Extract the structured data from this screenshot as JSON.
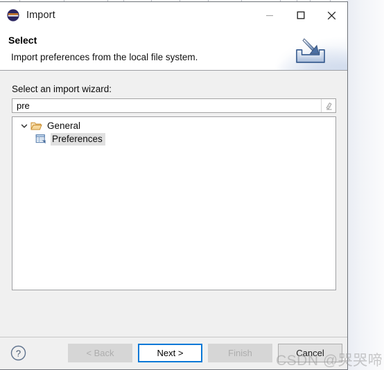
{
  "window": {
    "title": "Import",
    "app_icon": "eclipse-logo-icon",
    "controls": {
      "minimize": "minimize-icon",
      "maximize": "maximize-icon",
      "close": "close-icon"
    }
  },
  "banner": {
    "title": "Select",
    "description": "Import preferences from the local file system.",
    "icon": "import-tray-arrow-icon"
  },
  "form": {
    "wizard_label": "Select an import wizard:",
    "filter_value": "pre",
    "filter_placeholder": "",
    "clear_icon": "eraser-clear-icon"
  },
  "tree": {
    "nodes": [
      {
        "label": "General",
        "icon": "open-folder-icon",
        "expanded": true,
        "selected": false,
        "twisty": "chevron-down-icon",
        "children": [
          {
            "label": "Preferences",
            "icon": "preferences-table-icon",
            "selected": true
          }
        ]
      }
    ]
  },
  "footer": {
    "help_icon": "help-question-icon",
    "buttons": [
      {
        "label": "< Back",
        "state": "disabled"
      },
      {
        "label": "Next >",
        "state": "default"
      },
      {
        "label": "Finish",
        "state": "disabled"
      },
      {
        "label": "Cancel",
        "state": "enabled"
      }
    ]
  },
  "watermark": {
    "text": "CSDN @哭哭啼"
  },
  "colors": {
    "accent": "#0078d7",
    "dialog_bg": "#f0f0f0",
    "field_bg": "#ffffff",
    "selection": "#e0e0e0",
    "folder": "#e8b96a"
  }
}
